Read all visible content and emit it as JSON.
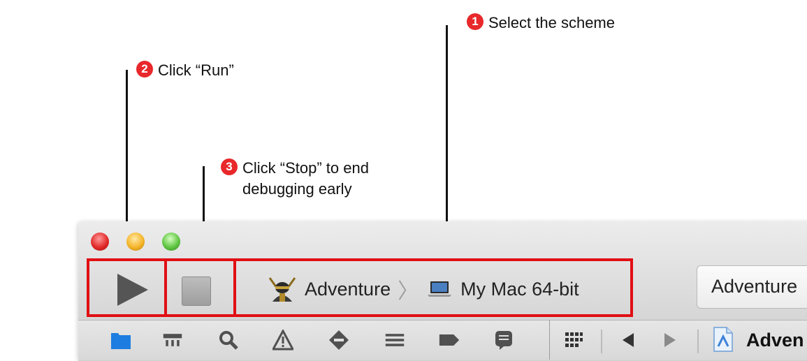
{
  "callouts": {
    "one": {
      "number": "1",
      "text": "Select the scheme"
    },
    "two": {
      "number": "2",
      "text": "Click “Run”"
    },
    "three": {
      "number": "3",
      "line1": "Click “Stop” to end",
      "line2": "debugging early"
    }
  },
  "toolbar": {
    "run_label": "Run",
    "stop_label": "Stop",
    "scheme_name": "Adventure",
    "destination": "My Mac 64-bit",
    "activity_title": "Adventure"
  },
  "navigator": {
    "icons": [
      "project-navigator-icon",
      "symbol-navigator-icon",
      "find-navigator-icon",
      "issue-navigator-icon",
      "test-navigator-icon",
      "debug-navigator-icon",
      "breakpoint-navigator-icon",
      "log-navigator-icon"
    ]
  },
  "jump_bar": {
    "file_label": "Adven"
  },
  "colors": {
    "highlight": "#e10f14",
    "badge": "#e8282b"
  }
}
